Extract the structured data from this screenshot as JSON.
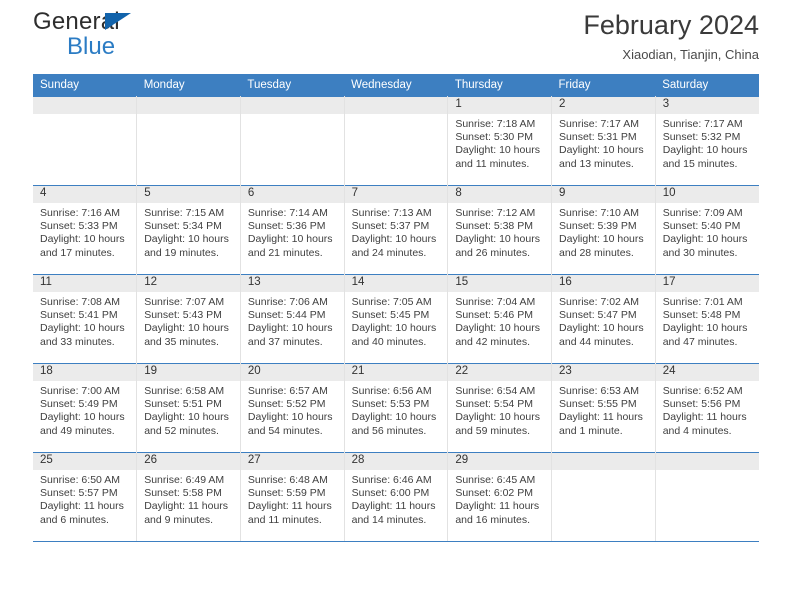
{
  "brand": {
    "line1": "General",
    "line2": "Blue",
    "triangle_color": "#1263ab",
    "blue_color": "#2b7cc4"
  },
  "header": {
    "title": "February 2024",
    "subtitle": "Xiaodian, Tianjin, China",
    "header_bg": "#3d7fc1"
  },
  "weekday_headers": [
    "Sunday",
    "Monday",
    "Tuesday",
    "Wednesday",
    "Thursday",
    "Friday",
    "Saturday"
  ],
  "labels": {
    "sunrise": "Sunrise:",
    "sunset": "Sunset:",
    "daylight": "Daylight:"
  },
  "weeks": [
    [
      {
        "day": ""
      },
      {
        "day": ""
      },
      {
        "day": ""
      },
      {
        "day": ""
      },
      {
        "day": "1",
        "sunrise": "Sunrise: 7:18 AM",
        "sunset": "Sunset: 5:30 PM",
        "daylight1": "Daylight: 10 hours",
        "daylight2": "and 11 minutes."
      },
      {
        "day": "2",
        "sunrise": "Sunrise: 7:17 AM",
        "sunset": "Sunset: 5:31 PM",
        "daylight1": "Daylight: 10 hours",
        "daylight2": "and 13 minutes."
      },
      {
        "day": "3",
        "sunrise": "Sunrise: 7:17 AM",
        "sunset": "Sunset: 5:32 PM",
        "daylight1": "Daylight: 10 hours",
        "daylight2": "and 15 minutes."
      }
    ],
    [
      {
        "day": "4",
        "sunrise": "Sunrise: 7:16 AM",
        "sunset": "Sunset: 5:33 PM",
        "daylight1": "Daylight: 10 hours",
        "daylight2": "and 17 minutes."
      },
      {
        "day": "5",
        "sunrise": "Sunrise: 7:15 AM",
        "sunset": "Sunset: 5:34 PM",
        "daylight1": "Daylight: 10 hours",
        "daylight2": "and 19 minutes."
      },
      {
        "day": "6",
        "sunrise": "Sunrise: 7:14 AM",
        "sunset": "Sunset: 5:36 PM",
        "daylight1": "Daylight: 10 hours",
        "daylight2": "and 21 minutes."
      },
      {
        "day": "7",
        "sunrise": "Sunrise: 7:13 AM",
        "sunset": "Sunset: 5:37 PM",
        "daylight1": "Daylight: 10 hours",
        "daylight2": "and 24 minutes."
      },
      {
        "day": "8",
        "sunrise": "Sunrise: 7:12 AM",
        "sunset": "Sunset: 5:38 PM",
        "daylight1": "Daylight: 10 hours",
        "daylight2": "and 26 minutes."
      },
      {
        "day": "9",
        "sunrise": "Sunrise: 7:10 AM",
        "sunset": "Sunset: 5:39 PM",
        "daylight1": "Daylight: 10 hours",
        "daylight2": "and 28 minutes."
      },
      {
        "day": "10",
        "sunrise": "Sunrise: 7:09 AM",
        "sunset": "Sunset: 5:40 PM",
        "daylight1": "Daylight: 10 hours",
        "daylight2": "and 30 minutes."
      }
    ],
    [
      {
        "day": "11",
        "sunrise": "Sunrise: 7:08 AM",
        "sunset": "Sunset: 5:41 PM",
        "daylight1": "Daylight: 10 hours",
        "daylight2": "and 33 minutes."
      },
      {
        "day": "12",
        "sunrise": "Sunrise: 7:07 AM",
        "sunset": "Sunset: 5:43 PM",
        "daylight1": "Daylight: 10 hours",
        "daylight2": "and 35 minutes."
      },
      {
        "day": "13",
        "sunrise": "Sunrise: 7:06 AM",
        "sunset": "Sunset: 5:44 PM",
        "daylight1": "Daylight: 10 hours",
        "daylight2": "and 37 minutes."
      },
      {
        "day": "14",
        "sunrise": "Sunrise: 7:05 AM",
        "sunset": "Sunset: 5:45 PM",
        "daylight1": "Daylight: 10 hours",
        "daylight2": "and 40 minutes."
      },
      {
        "day": "15",
        "sunrise": "Sunrise: 7:04 AM",
        "sunset": "Sunset: 5:46 PM",
        "daylight1": "Daylight: 10 hours",
        "daylight2": "and 42 minutes."
      },
      {
        "day": "16",
        "sunrise": "Sunrise: 7:02 AM",
        "sunset": "Sunset: 5:47 PM",
        "daylight1": "Daylight: 10 hours",
        "daylight2": "and 44 minutes."
      },
      {
        "day": "17",
        "sunrise": "Sunrise: 7:01 AM",
        "sunset": "Sunset: 5:48 PM",
        "daylight1": "Daylight: 10 hours",
        "daylight2": "and 47 minutes."
      }
    ],
    [
      {
        "day": "18",
        "sunrise": "Sunrise: 7:00 AM",
        "sunset": "Sunset: 5:49 PM",
        "daylight1": "Daylight: 10 hours",
        "daylight2": "and 49 minutes."
      },
      {
        "day": "19",
        "sunrise": "Sunrise: 6:58 AM",
        "sunset": "Sunset: 5:51 PM",
        "daylight1": "Daylight: 10 hours",
        "daylight2": "and 52 minutes."
      },
      {
        "day": "20",
        "sunrise": "Sunrise: 6:57 AM",
        "sunset": "Sunset: 5:52 PM",
        "daylight1": "Daylight: 10 hours",
        "daylight2": "and 54 minutes."
      },
      {
        "day": "21",
        "sunrise": "Sunrise: 6:56 AM",
        "sunset": "Sunset: 5:53 PM",
        "daylight1": "Daylight: 10 hours",
        "daylight2": "and 56 minutes."
      },
      {
        "day": "22",
        "sunrise": "Sunrise: 6:54 AM",
        "sunset": "Sunset: 5:54 PM",
        "daylight1": "Daylight: 10 hours",
        "daylight2": "and 59 minutes."
      },
      {
        "day": "23",
        "sunrise": "Sunrise: 6:53 AM",
        "sunset": "Sunset: 5:55 PM",
        "daylight1": "Daylight: 11 hours",
        "daylight2": "and 1 minute."
      },
      {
        "day": "24",
        "sunrise": "Sunrise: 6:52 AM",
        "sunset": "Sunset: 5:56 PM",
        "daylight1": "Daylight: 11 hours",
        "daylight2": "and 4 minutes."
      }
    ],
    [
      {
        "day": "25",
        "sunrise": "Sunrise: 6:50 AM",
        "sunset": "Sunset: 5:57 PM",
        "daylight1": "Daylight: 11 hours",
        "daylight2": "and 6 minutes."
      },
      {
        "day": "26",
        "sunrise": "Sunrise: 6:49 AM",
        "sunset": "Sunset: 5:58 PM",
        "daylight1": "Daylight: 11 hours",
        "daylight2": "and 9 minutes."
      },
      {
        "day": "27",
        "sunrise": "Sunrise: 6:48 AM",
        "sunset": "Sunset: 5:59 PM",
        "daylight1": "Daylight: 11 hours",
        "daylight2": "and 11 minutes."
      },
      {
        "day": "28",
        "sunrise": "Sunrise: 6:46 AM",
        "sunset": "Sunset: 6:00 PM",
        "daylight1": "Daylight: 11 hours",
        "daylight2": "and 14 minutes."
      },
      {
        "day": "29",
        "sunrise": "Sunrise: 6:45 AM",
        "sunset": "Sunset: 6:02 PM",
        "daylight1": "Daylight: 11 hours",
        "daylight2": "and 16 minutes."
      },
      {
        "day": ""
      },
      {
        "day": ""
      }
    ]
  ]
}
